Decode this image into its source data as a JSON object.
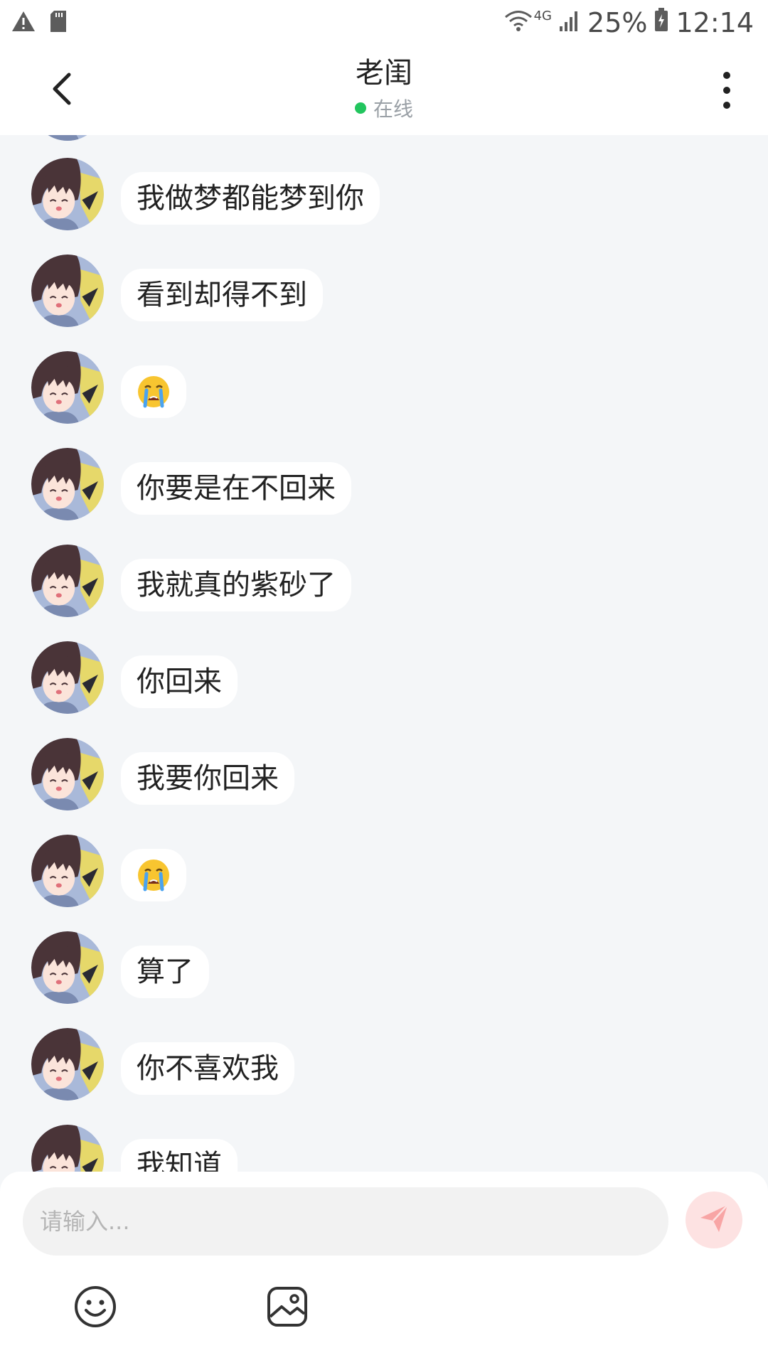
{
  "status_bar": {
    "network": "4G",
    "battery_percent": "25%",
    "time": "12:14"
  },
  "header": {
    "title": "老闺",
    "presence": "在线"
  },
  "messages": [
    {
      "type": "text",
      "text": "我做梦都能梦到你"
    },
    {
      "type": "text",
      "text": "看到却得不到"
    },
    {
      "type": "emoji",
      "icon": "crying-face-emoji"
    },
    {
      "type": "text",
      "text": "你要是在不回来"
    },
    {
      "type": "text",
      "text": "我就真的紫砂了"
    },
    {
      "type": "text",
      "text": "你回来"
    },
    {
      "type": "text",
      "text": "我要你回来"
    },
    {
      "type": "emoji",
      "icon": "crying-face-emoji"
    },
    {
      "type": "text",
      "text": "算了"
    },
    {
      "type": "text",
      "text": "你不喜欢我"
    },
    {
      "type": "text",
      "text": "我知道"
    }
  ],
  "composer": {
    "placeholder": "请输入...",
    "value": ""
  },
  "colors": {
    "online": "#22c55e",
    "send_button_bg": "#fde2e2",
    "send_icon": "#f8a5a5",
    "background": "#f4f6f8"
  }
}
